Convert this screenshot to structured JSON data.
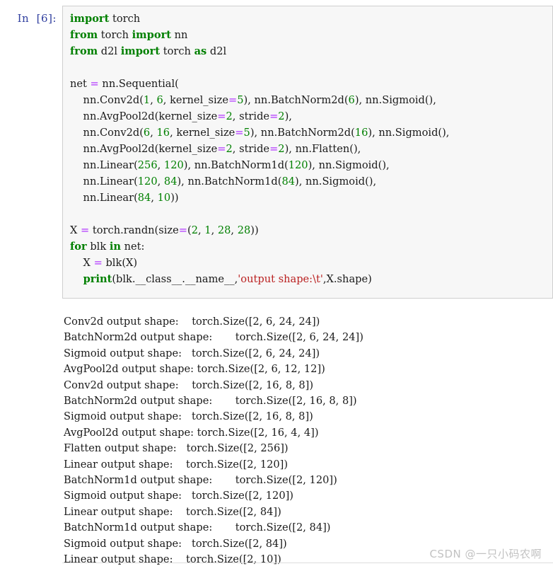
{
  "cell": {
    "prompt_label": "In  [6]:",
    "execution_count": 6,
    "code_lines": [
      [
        {
          "t": "kw",
          "v": "import"
        },
        {
          "t": "pln",
          "v": " torch"
        }
      ],
      [
        {
          "t": "kw",
          "v": "from"
        },
        {
          "t": "pln",
          "v": " torch "
        },
        {
          "t": "kw",
          "v": "import"
        },
        {
          "t": "pln",
          "v": " nn"
        }
      ],
      [
        {
          "t": "kw",
          "v": "from"
        },
        {
          "t": "pln",
          "v": " d2l "
        },
        {
          "t": "kw",
          "v": "import"
        },
        {
          "t": "pln",
          "v": " torch "
        },
        {
          "t": "kw",
          "v": "as"
        },
        {
          "t": "pln",
          "v": " d2l"
        }
      ],
      [],
      [
        {
          "t": "pln",
          "v": "net "
        },
        {
          "t": "op",
          "v": "="
        },
        {
          "t": "pln",
          "v": " nn.Sequential("
        }
      ],
      [
        {
          "t": "pln",
          "v": "    nn.Conv2d("
        },
        {
          "t": "num",
          "v": "1"
        },
        {
          "t": "pln",
          "v": ", "
        },
        {
          "t": "num",
          "v": "6"
        },
        {
          "t": "pln",
          "v": ", kernel_size"
        },
        {
          "t": "op",
          "v": "="
        },
        {
          "t": "num",
          "v": "5"
        },
        {
          "t": "pln",
          "v": "), nn.BatchNorm2d("
        },
        {
          "t": "num",
          "v": "6"
        },
        {
          "t": "pln",
          "v": "), nn.Sigmoid(),"
        }
      ],
      [
        {
          "t": "pln",
          "v": "    nn.AvgPool2d(kernel_size"
        },
        {
          "t": "op",
          "v": "="
        },
        {
          "t": "num",
          "v": "2"
        },
        {
          "t": "pln",
          "v": ", stride"
        },
        {
          "t": "op",
          "v": "="
        },
        {
          "t": "num",
          "v": "2"
        },
        {
          "t": "pln",
          "v": "),"
        }
      ],
      [
        {
          "t": "pln",
          "v": "    nn.Conv2d("
        },
        {
          "t": "num",
          "v": "6"
        },
        {
          "t": "pln",
          "v": ", "
        },
        {
          "t": "num",
          "v": "16"
        },
        {
          "t": "pln",
          "v": ", kernel_size"
        },
        {
          "t": "op",
          "v": "="
        },
        {
          "t": "num",
          "v": "5"
        },
        {
          "t": "pln",
          "v": "), nn.BatchNorm2d("
        },
        {
          "t": "num",
          "v": "16"
        },
        {
          "t": "pln",
          "v": "), nn.Sigmoid(),"
        }
      ],
      [
        {
          "t": "pln",
          "v": "    nn.AvgPool2d(kernel_size"
        },
        {
          "t": "op",
          "v": "="
        },
        {
          "t": "num",
          "v": "2"
        },
        {
          "t": "pln",
          "v": ", stride"
        },
        {
          "t": "op",
          "v": "="
        },
        {
          "t": "num",
          "v": "2"
        },
        {
          "t": "pln",
          "v": "), nn.Flatten(),"
        }
      ],
      [
        {
          "t": "pln",
          "v": "    nn.Linear("
        },
        {
          "t": "num",
          "v": "256"
        },
        {
          "t": "pln",
          "v": ", "
        },
        {
          "t": "num",
          "v": "120"
        },
        {
          "t": "pln",
          "v": "), nn.BatchNorm1d("
        },
        {
          "t": "num",
          "v": "120"
        },
        {
          "t": "pln",
          "v": "), nn.Sigmoid(),"
        }
      ],
      [
        {
          "t": "pln",
          "v": "    nn.Linear("
        },
        {
          "t": "num",
          "v": "120"
        },
        {
          "t": "pln",
          "v": ", "
        },
        {
          "t": "num",
          "v": "84"
        },
        {
          "t": "pln",
          "v": "), nn.BatchNorm1d("
        },
        {
          "t": "num",
          "v": "84"
        },
        {
          "t": "pln",
          "v": "), nn.Sigmoid(),"
        }
      ],
      [
        {
          "t": "pln",
          "v": "    nn.Linear("
        },
        {
          "t": "num",
          "v": "84"
        },
        {
          "t": "pln",
          "v": ", "
        },
        {
          "t": "num",
          "v": "10"
        },
        {
          "t": "pln",
          "v": "))"
        }
      ],
      [],
      [
        {
          "t": "pln",
          "v": "X "
        },
        {
          "t": "op",
          "v": "="
        },
        {
          "t": "pln",
          "v": " torch.randn(size"
        },
        {
          "t": "op",
          "v": "="
        },
        {
          "t": "pln",
          "v": "("
        },
        {
          "t": "num",
          "v": "2"
        },
        {
          "t": "pln",
          "v": ", "
        },
        {
          "t": "num",
          "v": "1"
        },
        {
          "t": "pln",
          "v": ", "
        },
        {
          "t": "num",
          "v": "28"
        },
        {
          "t": "pln",
          "v": ", "
        },
        {
          "t": "num",
          "v": "28"
        },
        {
          "t": "pln",
          "v": "))"
        }
      ],
      [
        {
          "t": "kw",
          "v": "for"
        },
        {
          "t": "pln",
          "v": " blk "
        },
        {
          "t": "kw",
          "v": "in"
        },
        {
          "t": "pln",
          "v": " net:"
        }
      ],
      [
        {
          "t": "pln",
          "v": "    X "
        },
        {
          "t": "op",
          "v": "="
        },
        {
          "t": "pln",
          "v": " blk(X)"
        }
      ],
      [
        {
          "t": "pln",
          "v": "    "
        },
        {
          "t": "kw",
          "v": "print"
        },
        {
          "t": "pln",
          "v": "(blk.__class__.__name__,"
        },
        {
          "t": "str",
          "v": "'output shape:\\t'"
        },
        {
          "t": "pln",
          "v": ",X.shape)"
        }
      ]
    ]
  },
  "output": {
    "columns": [
      "layer",
      "label",
      "shape"
    ],
    "rows": [
      {
        "layer": "Conv2d",
        "label": "output shape:",
        "shape": "torch.Size([2, 6, 24, 24])"
      },
      {
        "layer": "BatchNorm2d",
        "label": "output shape:",
        "shape": "torch.Size([2, 6, 24, 24])"
      },
      {
        "layer": "Sigmoid",
        "label": "output shape:",
        "shape": "torch.Size([2, 6, 24, 24])"
      },
      {
        "layer": "AvgPool2d",
        "label": "output shape:",
        "shape": "torch.Size([2, 6, 12, 12])"
      },
      {
        "layer": "Conv2d",
        "label": "output shape:",
        "shape": "torch.Size([2, 16, 8, 8])"
      },
      {
        "layer": "BatchNorm2d",
        "label": "output shape:",
        "shape": "torch.Size([2, 16, 8, 8])"
      },
      {
        "layer": "Sigmoid",
        "label": "output shape:",
        "shape": "torch.Size([2, 16, 8, 8])"
      },
      {
        "layer": "AvgPool2d",
        "label": "output shape:",
        "shape": "torch.Size([2, 16, 4, 4])"
      },
      {
        "layer": "Flatten",
        "label": "output shape:",
        "shape": "torch.Size([2, 256])"
      },
      {
        "layer": "Linear",
        "label": "output shape:",
        "shape": "torch.Size([2, 120])"
      },
      {
        "layer": "BatchNorm1d",
        "label": "output shape:",
        "shape": "torch.Size([2, 120])"
      },
      {
        "layer": "Sigmoid",
        "label": "output shape:",
        "shape": "torch.Size([2, 120])"
      },
      {
        "layer": "Linear",
        "label": "output shape:",
        "shape": "torch.Size([2, 84])"
      },
      {
        "layer": "BatchNorm1d",
        "label": "output shape:",
        "shape": "torch.Size([2, 84])"
      },
      {
        "layer": "Sigmoid",
        "label": "output shape:",
        "shape": "torch.Size([2, 84])"
      },
      {
        "layer": "Linear",
        "label": "output shape:",
        "shape": "torch.Size([2, 10])"
      }
    ],
    "tab_stop": 8
  },
  "watermark": {
    "text": "CSDN @一只小码农啊"
  },
  "colors": {
    "keyword": "#008000",
    "number": "#008000",
    "operator": "#aa22ff",
    "string": "#ba2121",
    "prompt": "#303f9f",
    "cell_background": "#f7f7f7",
    "cell_border": "#cfcfcf",
    "page_background": "#ffffff",
    "watermark": "#c2c2c2"
  }
}
